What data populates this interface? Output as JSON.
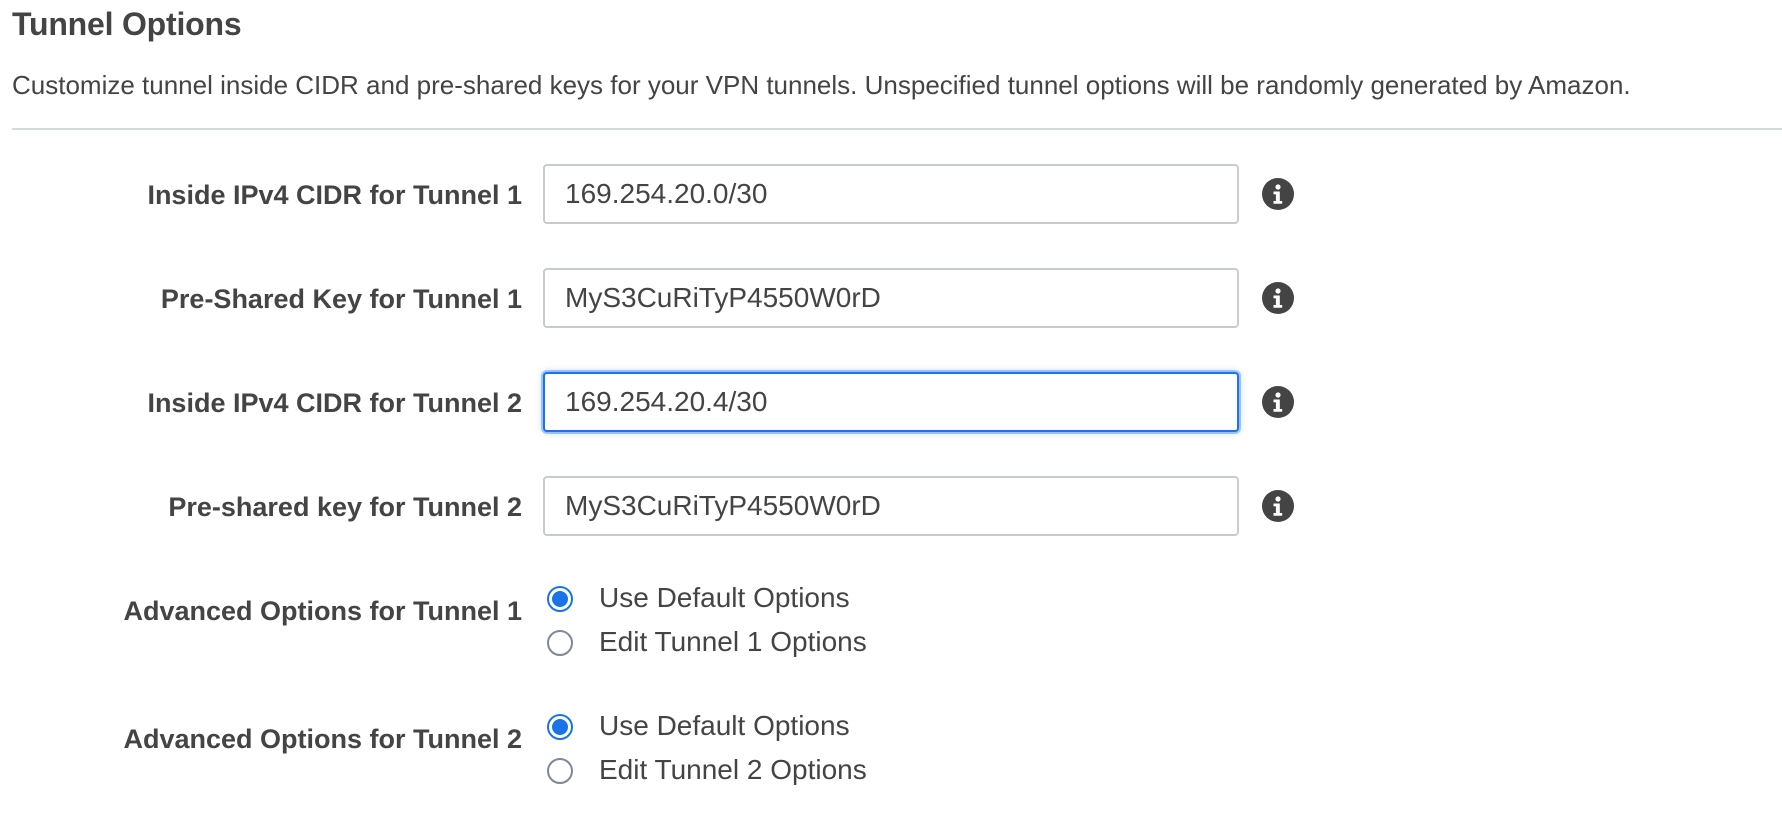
{
  "section": {
    "title": "Tunnel Options",
    "description": "Customize tunnel inside CIDR and pre-shared keys for your VPN tunnels. Unspecified tunnel options will be randomly generated by Amazon."
  },
  "fields": [
    {
      "label": "Inside IPv4 CIDR for Tunnel 1",
      "value": "169.254.20.0/30",
      "icon": "info-icon"
    },
    {
      "label": "Pre-Shared Key for Tunnel 1",
      "value": "MyS3CuRiTyP4550W0rD",
      "icon": "info-icon"
    },
    {
      "label": "Inside IPv4 CIDR for Tunnel 2",
      "value": "169.254.20.4/30",
      "icon": "info-icon",
      "focused": true
    },
    {
      "label": "Pre-shared key for Tunnel 2",
      "value": "MyS3CuRiTyP4550W0rD",
      "icon": "info-icon"
    }
  ],
  "advanced": [
    {
      "label": "Advanced Options for Tunnel 1",
      "options": [
        {
          "label": "Use Default Options",
          "checked": true
        },
        {
          "label": "Edit Tunnel 1 Options",
          "checked": false
        }
      ]
    },
    {
      "label": "Advanced Options for Tunnel 2",
      "options": [
        {
          "label": "Use Default Options",
          "checked": true
        },
        {
          "label": "Edit Tunnel 2 Options",
          "checked": false
        }
      ]
    }
  ],
  "colors": {
    "accent": "#1a73e8",
    "text": "#444444",
    "border": "#c7cccc",
    "divider": "#d5dbdb"
  }
}
